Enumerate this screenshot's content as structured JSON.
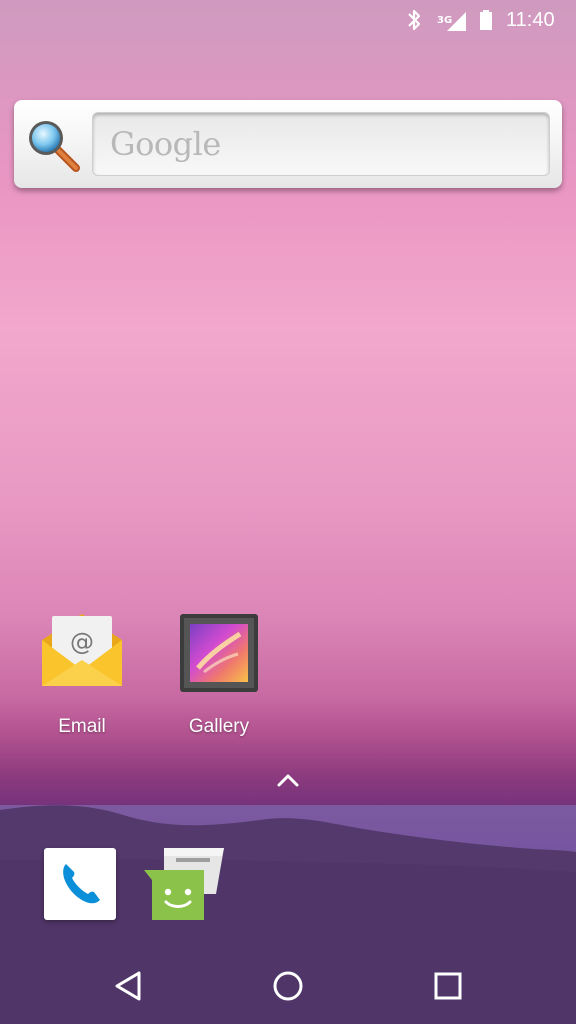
{
  "status_bar": {
    "network_type": "3G",
    "time": "11:40",
    "icons": [
      "bluetooth-icon",
      "cell-signal-icon",
      "battery-icon"
    ]
  },
  "search_widget": {
    "placeholder": "Google",
    "icon": "magnifier-icon"
  },
  "home_apps": [
    {
      "label": "Email",
      "icon": "email-icon"
    },
    {
      "label": "Gallery",
      "icon": "gallery-icon"
    }
  ],
  "app_drawer_handle": {
    "icon": "chevron-up-icon"
  },
  "dock": [
    {
      "app": "phone",
      "icon": "phone-icon"
    },
    {
      "app": "messaging",
      "icon": "messaging-icon"
    }
  ],
  "nav_bar": {
    "buttons": [
      {
        "name": "back",
        "icon": "back-triangle-icon"
      },
      {
        "name": "home",
        "icon": "home-circle-icon"
      },
      {
        "name": "recents",
        "icon": "recents-square-icon"
      }
    ]
  },
  "colors": {
    "email_envelope": "#f9c42c",
    "phone_blue": "#0b8fd8",
    "messaging_green": "#8bc34a"
  }
}
